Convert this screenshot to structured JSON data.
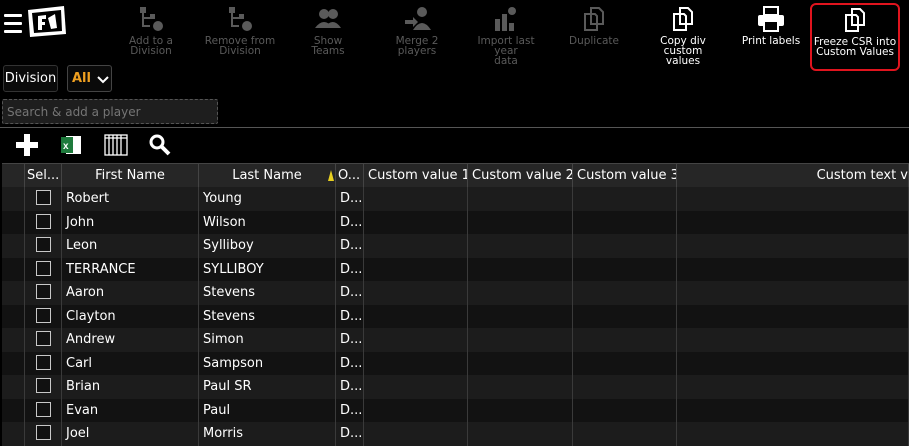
{
  "toolbar": {
    "buttons": [
      {
        "label": "Add to a\nDivision",
        "disabled": true
      },
      {
        "label": "Remove from\nDivision",
        "disabled": true
      },
      {
        "label": "Show Teams",
        "disabled": true
      },
      {
        "label": "Merge 2 players",
        "disabled": true
      },
      {
        "label": "Import last year\ndata",
        "disabled": true
      },
      {
        "label": "Duplicate",
        "disabled": true
      },
      {
        "label": "Copy div\ncustom values",
        "disabled": false
      },
      {
        "label": "Print labels",
        "disabled": false
      },
      {
        "label": "Freeze CSR into\nCustom Values",
        "disabled": false
      }
    ]
  },
  "filters": {
    "division_label": "Division",
    "division_value": "All",
    "search_placeholder": "Search & add a player"
  },
  "grid": {
    "columns": [
      "Sel...",
      "First Name",
      "Last Name",
      "O...",
      "Custom value 1",
      "Custom value 2",
      "Custom value 3",
      "Custom text v"
    ],
    "rows": [
      {
        "first": "Robert",
        "last": "Young",
        "o": "D..."
      },
      {
        "first": "John",
        "last": "Wilson",
        "o": "D..."
      },
      {
        "first": "Leon",
        "last": "Sylliboy",
        "o": "D..."
      },
      {
        "first": "TERRANCE",
        "last": "SYLLIBOY",
        "o": "D..."
      },
      {
        "first": "Aaron",
        "last": "Stevens",
        "o": "D..."
      },
      {
        "first": "Clayton",
        "last": "Stevens",
        "o": "D..."
      },
      {
        "first": "Andrew",
        "last": "Simon",
        "o": "D..."
      },
      {
        "first": "Carl",
        "last": "Sampson",
        "o": "D..."
      },
      {
        "first": "Brian",
        "last": "Paul SR",
        "o": "D..."
      },
      {
        "first": "Evan",
        "last": "Paul",
        "o": "D..."
      },
      {
        "first": "Joel",
        "last": "Morris",
        "o": "D..."
      }
    ]
  },
  "colors": {
    "accent": "#f0a020",
    "highlight_border": "#e0141e",
    "sort_indicator": "#e8d020"
  }
}
